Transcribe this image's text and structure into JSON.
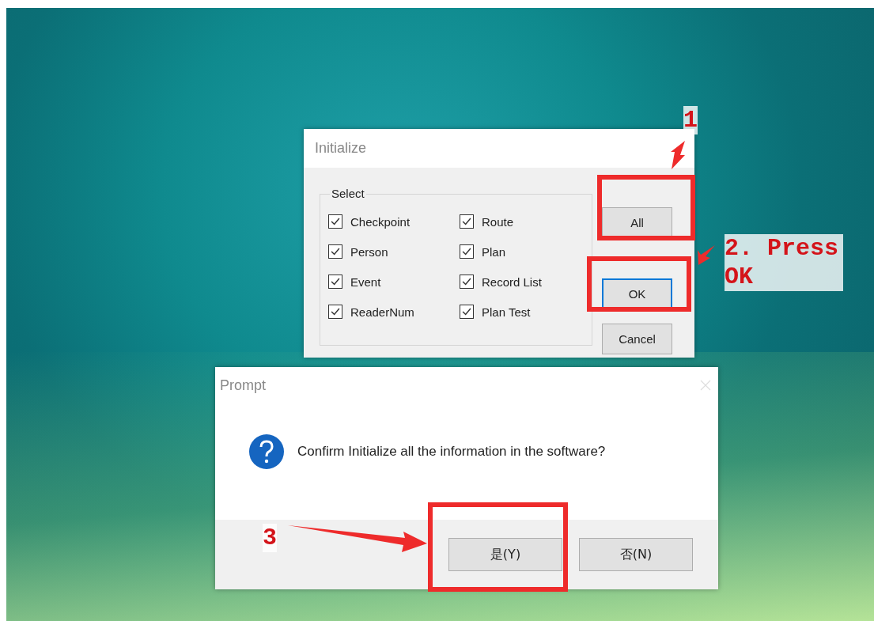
{
  "initialize_dialog": {
    "title": "Initialize",
    "group_label": "Select",
    "options": [
      {
        "label": "Checkpoint",
        "checked": true
      },
      {
        "label": "Person",
        "checked": true
      },
      {
        "label": "Event",
        "checked": true
      },
      {
        "label": "ReaderNum",
        "checked": true
      },
      {
        "label": "Route",
        "checked": true
      },
      {
        "label": "Plan",
        "checked": true
      },
      {
        "label": "Record List",
        "checked": true
      },
      {
        "label": "Plan Test",
        "checked": true
      }
    ],
    "buttons": [
      {
        "label": "All",
        "focused": false
      },
      {
        "label": "OK",
        "focused": true
      },
      {
        "label": "Cancel",
        "focused": false
      }
    ]
  },
  "prompt_dialog": {
    "title": "Prompt",
    "message": "Confirm Initialize all the information in the software?",
    "buttons": [
      {
        "label": "是(Y)"
      },
      {
        "label": "否(N)"
      }
    ]
  },
  "annotations": [
    {
      "label": "1"
    },
    {
      "label": "2. Press OK"
    },
    {
      "label": "3"
    }
  ]
}
